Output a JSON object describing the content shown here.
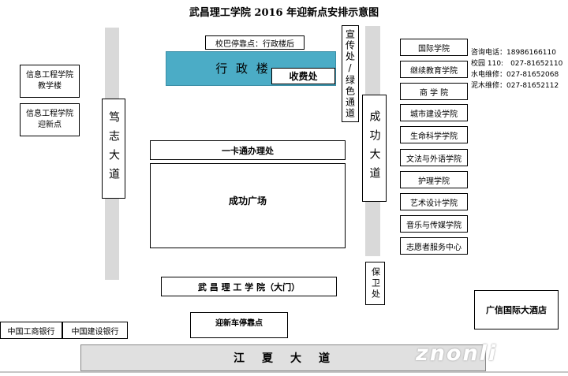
{
  "title": "武昌理工学院 2016 年迎新点安排示意图",
  "bus_stop_note": "校巴停靠点：行政楼后",
  "admin_building": "行 政 楼",
  "fee_office": "收费处",
  "green_channel": "宣传处/绿色通道",
  "road_duzhi": "笃志大道",
  "road_chenggong": "成功大道",
  "road_jiangxia": "江　夏　大　道",
  "info_eng_building": "信息工程学院教学楼",
  "info_eng_welcome": "信息工程学院迎新点",
  "card_office": "一卡通办理处",
  "square": "成功广场",
  "main_gate": "武 昌 理 工 学 院（大门）",
  "security": "保卫处",
  "welcome_bus_stop": "迎新车停靠点",
  "banks": [
    "中国工商银行",
    "中国建设银行"
  ],
  "hotel": "广信国际大酒店",
  "departments": [
    "国际学院",
    "继续教育学院",
    "商 学 院",
    "城市建设学院",
    "生命科学学院",
    "文法与外语学院",
    "护理学院",
    "艺术设计学院",
    "音乐与传媒学院",
    "志愿者服务中心"
  ],
  "contacts": [
    "咨询电话：18986166110",
    "校园 110:　027-81652110",
    "水电维修：027-81652068",
    "泥木维修：027-81652112"
  ],
  "watermark": "znonli",
  "colors": {
    "admin_fill": "#4bacc6",
    "road": "#d9d9d9"
  }
}
